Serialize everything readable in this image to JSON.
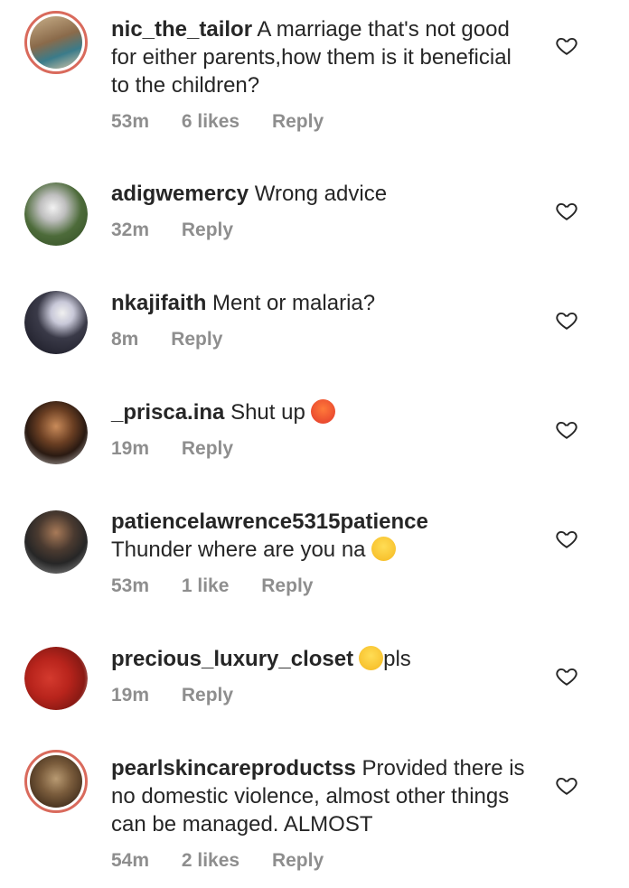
{
  "comments": [
    {
      "username": "nic_the_tailor",
      "text": " A marriage that's not good for either parents,how them is it beneficial to the children?",
      "time": "53m",
      "likes": "6 likes",
      "reply": "Reply"
    },
    {
      "username": "adigwemercy",
      "text": " Wrong advice",
      "time": "32m",
      "likes": "",
      "reply": "Reply"
    },
    {
      "username": "nkajifaith",
      "text": " Ment or malaria?",
      "time": "8m",
      "likes": "",
      "reply": "Reply"
    },
    {
      "username": "_prisca.ina",
      "text": " Shut up ",
      "time": "19m",
      "likes": "",
      "reply": "Reply"
    },
    {
      "username": "patiencelawrence5315patience",
      "text": "Thunder where are you na ",
      "time": "53m",
      "likes": "1 like",
      "reply": "Reply"
    },
    {
      "username": "precious_luxury_closet",
      "text": "pls",
      "time": "19m",
      "likes": "",
      "reply": "Reply"
    },
    {
      "username": "pearlskincareproductss",
      "text": " Provided there is no domestic violence, almost other things can be managed. ALMOST",
      "time": "54m",
      "likes": "2 likes",
      "reply": "Reply"
    }
  ],
  "icons": {
    "heart": "heart-outline-icon"
  },
  "colors": {
    "text": "#262626",
    "meta": "#8e8e8e",
    "story_ring": "#d96a5c"
  }
}
